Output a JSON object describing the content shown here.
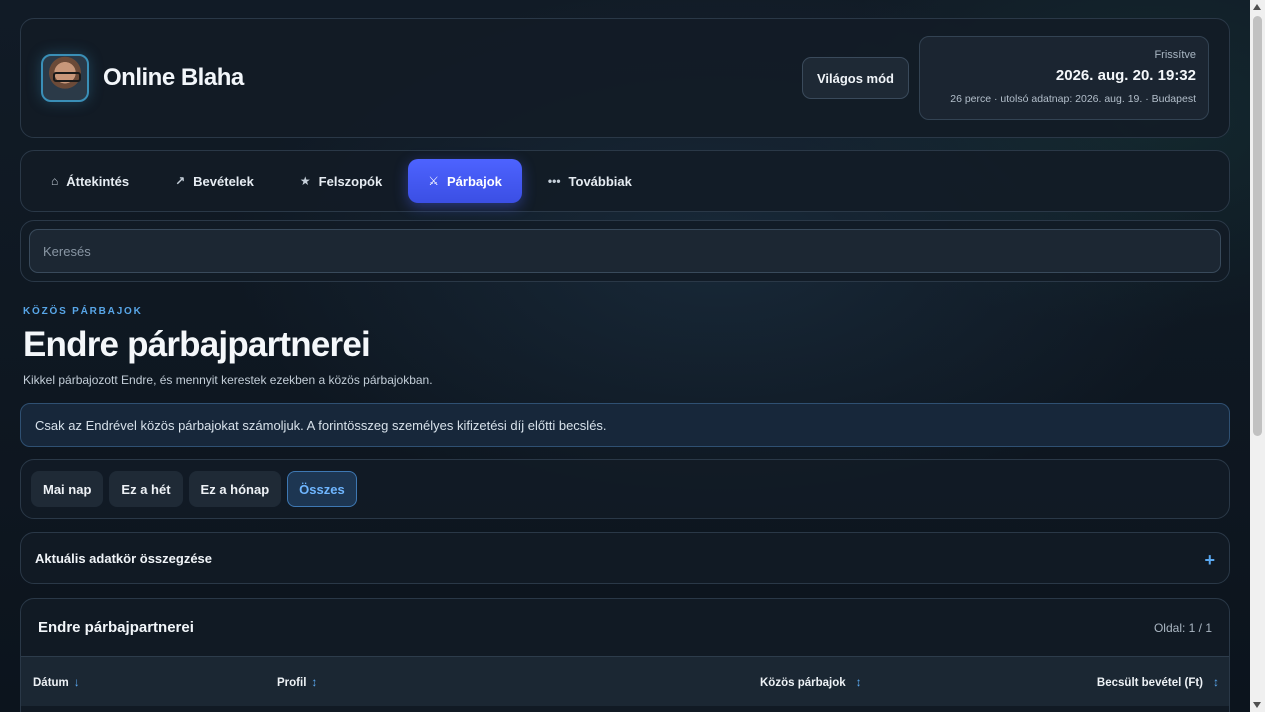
{
  "app": {
    "title": "Online Blaha"
  },
  "header": {
    "mode_button": "Világos mód",
    "updated_label": "Frissítve",
    "updated_date": "2026. aug. 20. 19:32",
    "updated_meta": "26 perce · utolsó adatnap: 2026. aug. 19. · Budapest"
  },
  "nav": {
    "tabs": [
      {
        "label": "Áttekintés",
        "icon": "home-icon",
        "glyph": "⌂",
        "active": false
      },
      {
        "label": "Bevételek",
        "icon": "trend-arrow-icon",
        "glyph": "↗",
        "active": false
      },
      {
        "label": "Felszopók",
        "icon": "star-icon",
        "glyph": "★",
        "active": false
      },
      {
        "label": "Párbajok",
        "icon": "crossed-swords-icon",
        "glyph": "⚔",
        "active": true
      },
      {
        "label": "Továbbiak",
        "icon": "more-dots-icon",
        "glyph": "•••",
        "active": false
      }
    ]
  },
  "search": {
    "placeholder": "Keresés",
    "value": ""
  },
  "section": {
    "eyebrow": "KÖZÖS PÁRBAJOK",
    "title": "Endre párbajpartnerei",
    "subtitle": "Kikkel párbajozott Endre, és mennyit kerestek ezekben a közös párbajokban.",
    "notice": "Csak az Endrével közös párbajokat számoljuk. A forintösszeg személyes kifizetési díj előtti becslés."
  },
  "filters": {
    "options": [
      "Mai nap",
      "Ez a hét",
      "Ez a hónap",
      "Összes"
    ],
    "selected": "Összes"
  },
  "summary": {
    "title": "Aktuális adatkör összegzése",
    "toggle": "+"
  },
  "table": {
    "title": "Endre párbajpartnerei",
    "pager": "Oldal: 1 / 1",
    "columns": [
      {
        "label": "Dátum",
        "sort": "↓"
      },
      {
        "label": "Profil",
        "sort": "↕"
      },
      {
        "label": "Közös párbajok",
        "sort": "↕"
      },
      {
        "label": "Becsült bevétel (Ft)",
        "sort": "↕"
      }
    ]
  },
  "colors": {
    "accent": "#4d63ff",
    "link_blue": "#5aa8f0",
    "background": "#0e1620",
    "panel": "#121b26"
  }
}
